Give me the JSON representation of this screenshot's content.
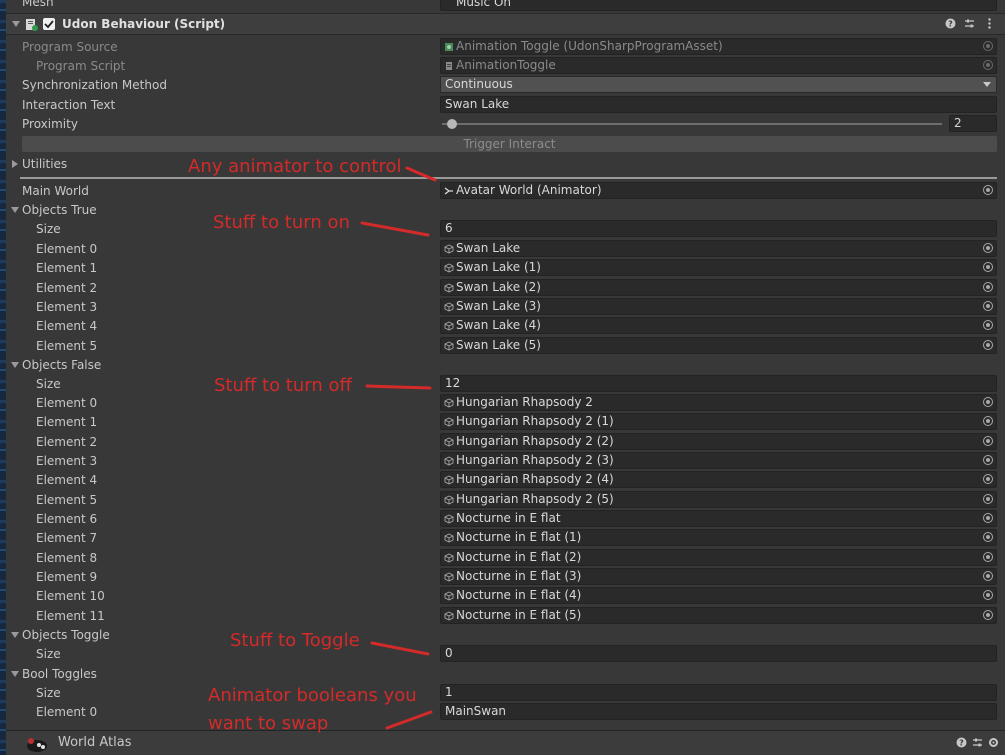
{
  "partial_top": {
    "label": "Mesh",
    "value": "Music On"
  },
  "component": {
    "title": "Udon Behaviour (Script)"
  },
  "rows": {
    "program_source": {
      "label": "Program Source",
      "value": "Animation Toggle (UdonSharpProgramAsset)"
    },
    "program_script": {
      "label": "Program Script",
      "value": "AnimationToggle"
    },
    "sync_method": {
      "label": "Synchronization Method",
      "value": "Continuous"
    },
    "interaction_text": {
      "label": "Interaction Text",
      "value": "Swan Lake"
    },
    "proximity": {
      "label": "Proximity",
      "value": 2,
      "min": 0,
      "max": 100
    },
    "trigger_button": "Trigger Interact",
    "utilities": "Utilities",
    "main_world": {
      "label": "Main World",
      "value": "Avatar World (Animator)"
    },
    "objects_true": {
      "label": "Objects True",
      "size_label": "Size",
      "size": "6",
      "elements": [
        {
          "label": "Element 0",
          "value": "Swan Lake"
        },
        {
          "label": "Element 1",
          "value": "Swan Lake (1)"
        },
        {
          "label": "Element 2",
          "value": "Swan Lake (2)"
        },
        {
          "label": "Element 3",
          "value": "Swan Lake (3)"
        },
        {
          "label": "Element 4",
          "value": "Swan Lake (4)"
        },
        {
          "label": "Element 5",
          "value": "Swan Lake (5)"
        }
      ]
    },
    "objects_false": {
      "label": "Objects False",
      "size_label": "Size",
      "size": "12",
      "elements": [
        {
          "label": "Element 0",
          "value": "Hungarian Rhapsody 2"
        },
        {
          "label": "Element 1",
          "value": "Hungarian Rhapsody 2 (1)"
        },
        {
          "label": "Element 2",
          "value": "Hungarian Rhapsody 2 (2)"
        },
        {
          "label": "Element 3",
          "value": "Hungarian Rhapsody 2 (3)"
        },
        {
          "label": "Element 4",
          "value": "Hungarian Rhapsody 2 (4)"
        },
        {
          "label": "Element 5",
          "value": "Hungarian Rhapsody 2 (5)"
        },
        {
          "label": "Element 6",
          "value": "Nocturne in E flat"
        },
        {
          "label": "Element 7",
          "value": "Nocturne in E flat (1)"
        },
        {
          "label": "Element 8",
          "value": "Nocturne in E flat (2)"
        },
        {
          "label": "Element 9",
          "value": "Nocturne in E flat (3)"
        },
        {
          "label": "Element 10",
          "value": "Nocturne in E flat (4)"
        },
        {
          "label": "Element 11",
          "value": "Nocturne in E flat (5)"
        }
      ]
    },
    "objects_toggle": {
      "label": "Objects Toggle",
      "size_label": "Size",
      "size": "0"
    },
    "bool_toggles": {
      "label": "Bool Toggles",
      "size_label": "Size",
      "size": "1",
      "elements": [
        {
          "label": "Element 0",
          "value": "MainSwan"
        }
      ]
    }
  },
  "annotations": {
    "animator": "Any animator to control",
    "turn_on": "Stuff to turn on",
    "turn_off": "Stuff to turn off",
    "toggle": "Stuff to Toggle",
    "bool_line1": "Animator booleans you",
    "bool_line2": "want to swap"
  },
  "footer": {
    "name": "World Atlas"
  },
  "icons": {
    "help": "help-icon",
    "presets": "presets-icon",
    "menu": "kebab-menu-icon",
    "script": "script-icon",
    "object": "game-object-icon",
    "animator": "animator-icon"
  },
  "colors": {
    "annotation": "#d42a2a",
    "panel": "#383838",
    "field": "#2a2a2a"
  }
}
